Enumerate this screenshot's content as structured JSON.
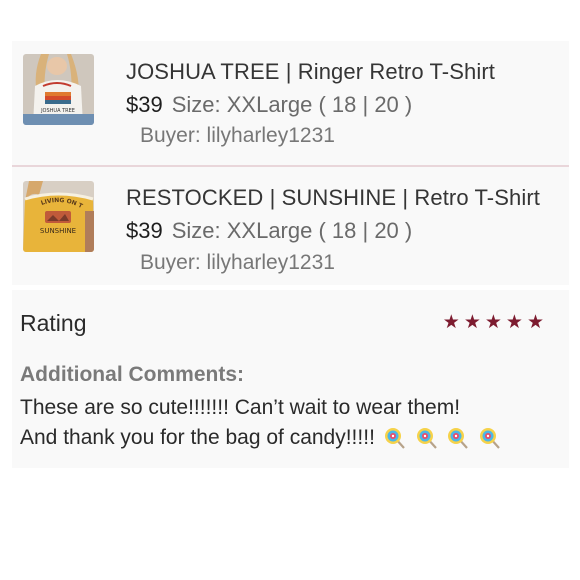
{
  "orders": [
    {
      "title": "JOSHUA TREE | Ringer Retro T-Shirt",
      "price": "$39",
      "size": "Size: XXLarge ( 18 | 20 )",
      "buyer": "Buyer: lilyharley1231",
      "thumb_text": "JOSHUA TREE"
    },
    {
      "title": "RESTOCKED | SUNSHINE | Retro T-Shirt",
      "price": "$39",
      "size": "Size: XXLarge ( 18 | 20 )",
      "buyer": "Buyer: lilyharley1231",
      "thumb_text": "SUNSHINE",
      "thumb_arc_text": "LIVING ON THE"
    }
  ],
  "rating": {
    "label": "Rating",
    "stars": 5,
    "max_stars": 5,
    "star_color": "#7d1c30"
  },
  "comments": {
    "label": "Additional Comments:",
    "line1": "These are so cute!!!!!!! Can’t wait to wear them!",
    "line2": "And thank you for the bag of candy!!!!!",
    "emoji": "lollipop-icon x4"
  }
}
